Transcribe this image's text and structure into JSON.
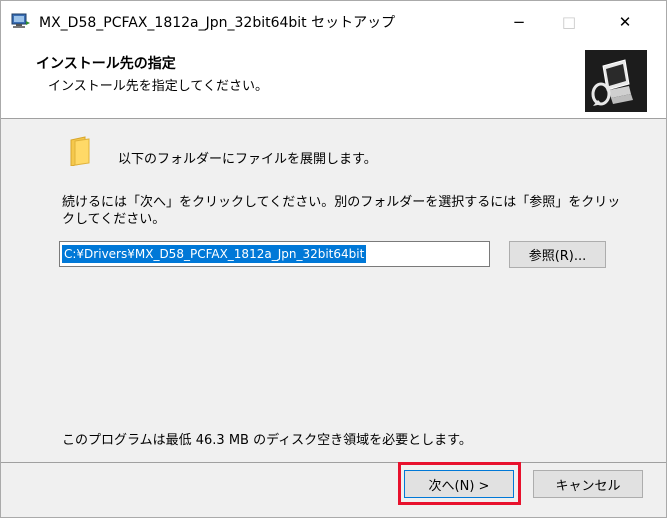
{
  "window": {
    "title": "MX_D58_PCFAX_1812a_Jpn_32bit64bit セットアップ",
    "app_icon": "installer-icon",
    "controls": {
      "minimize": "−",
      "maximize": "□",
      "close": "✕"
    }
  },
  "header": {
    "title": "インストール先の指定",
    "subtitle": "インストール先を指定してください。",
    "image": "computer-setup-icon"
  },
  "main": {
    "folder_icon": "folder-icon",
    "folder_text": "以下のフォルダーにファイルを展開します。",
    "instruction": "続けるには「次へ」をクリックしてください。別のフォルダーを選択するには「参照」をクリックしてください。",
    "path_value": "C:¥Drivers¥MX_D58_PCFAX_1812a_Jpn_32bit64bit",
    "browse_label": "参照(R)...",
    "disk_space": "このプログラムは最低 46.3 MB のディスク空き領域を必要とします。"
  },
  "footer": {
    "next_label": "次へ(N) >",
    "cancel_label": "キャンセル"
  },
  "colors": {
    "accent": "#0078d7",
    "highlight": "#e8112d",
    "dialog_bg": "#f0f0f0"
  }
}
